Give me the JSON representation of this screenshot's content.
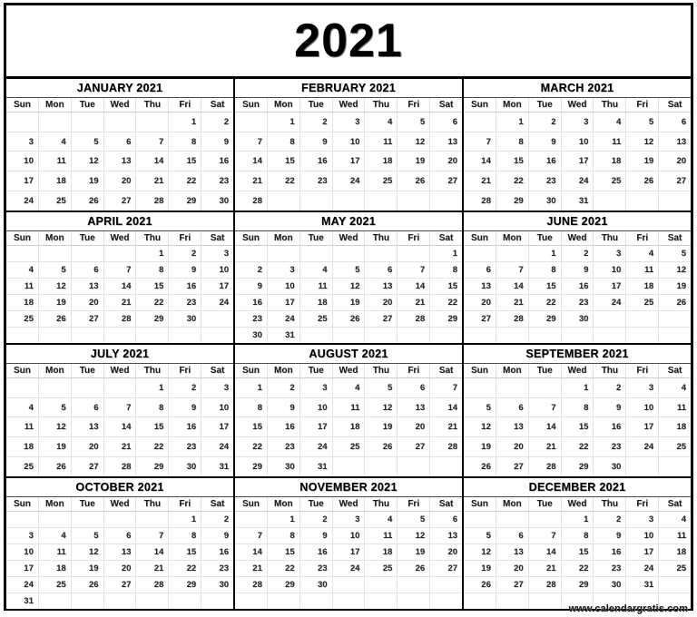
{
  "title": "2021",
  "watermark": "www.calendargratis.com",
  "weekdays": [
    "Sun",
    "Mon",
    "Tue",
    "Wed",
    "Thu",
    "Fri",
    "Sat"
  ],
  "colors": {
    "border": "#000000",
    "gridline": "#e2e2e2",
    "text": "#262626",
    "background": "#ffffff"
  },
  "quarters": [
    {
      "months": [
        {
          "name": "JANUARY 2021",
          "weeks": [
            [
              "",
              "",
              "",
              "",
              "",
              "1",
              "2"
            ],
            [
              "3",
              "4",
              "5",
              "6",
              "7",
              "8",
              "9"
            ],
            [
              "10",
              "11",
              "12",
              "13",
              "14",
              "15",
              "16"
            ],
            [
              "17",
              "18",
              "19",
              "20",
              "21",
              "22",
              "23"
            ],
            [
              "24",
              "25",
              "26",
              "27",
              "28",
              "29",
              "30"
            ]
          ]
        },
        {
          "name": "FEBRUARY 2021",
          "weeks": [
            [
              "",
              "1",
              "2",
              "3",
              "4",
              "5",
              "6"
            ],
            [
              "7",
              "8",
              "9",
              "10",
              "11",
              "12",
              "13"
            ],
            [
              "14",
              "15",
              "16",
              "17",
              "18",
              "19",
              "20"
            ],
            [
              "21",
              "22",
              "23",
              "24",
              "25",
              "26",
              "27"
            ],
            [
              "28",
              "",
              "",
              "",
              "",
              "",
              ""
            ]
          ]
        },
        {
          "name": "MARCH 2021",
          "weeks": [
            [
              "",
              "1",
              "2",
              "3",
              "4",
              "5",
              "6"
            ],
            [
              "7",
              "8",
              "9",
              "10",
              "11",
              "12",
              "13"
            ],
            [
              "14",
              "15",
              "16",
              "17",
              "18",
              "19",
              "20"
            ],
            [
              "21",
              "22",
              "23",
              "24",
              "25",
              "26",
              "27"
            ],
            [
              "28",
              "29",
              "30",
              "31",
              "",
              "",
              ""
            ]
          ]
        }
      ]
    },
    {
      "months": [
        {
          "name": "APRIL 2021",
          "weeks": [
            [
              "",
              "",
              "",
              "",
              "1",
              "2",
              "3"
            ],
            [
              "4",
              "5",
              "6",
              "7",
              "8",
              "9",
              "10"
            ],
            [
              "11",
              "12",
              "13",
              "14",
              "15",
              "16",
              "17"
            ],
            [
              "18",
              "19",
              "20",
              "21",
              "22",
              "23",
              "24"
            ],
            [
              "25",
              "26",
              "27",
              "28",
              "29",
              "30",
              ""
            ],
            [
              "",
              "",
              "",
              "",
              "",
              "",
              ""
            ]
          ]
        },
        {
          "name": "MAY 2021",
          "weeks": [
            [
              "",
              "",
              "",
              "",
              "",
              "",
              "1"
            ],
            [
              "2",
              "3",
              "4",
              "5",
              "6",
              "7",
              "8"
            ],
            [
              "9",
              "10",
              "11",
              "12",
              "13",
              "14",
              "15"
            ],
            [
              "16",
              "17",
              "18",
              "19",
              "20",
              "21",
              "22"
            ],
            [
              "23",
              "24",
              "25",
              "26",
              "27",
              "28",
              "29"
            ],
            [
              "30",
              "31",
              "",
              "",
              "",
              "",
              ""
            ]
          ]
        },
        {
          "name": "JUNE 2021",
          "weeks": [
            [
              "",
              "",
              "1",
              "2",
              "3",
              "4",
              "5"
            ],
            [
              "6",
              "7",
              "8",
              "9",
              "10",
              "11",
              "12"
            ],
            [
              "13",
              "14",
              "15",
              "16",
              "17",
              "18",
              "19"
            ],
            [
              "20",
              "21",
              "22",
              "23",
              "24",
              "25",
              "26"
            ],
            [
              "27",
              "28",
              "29",
              "30",
              "",
              "",
              ""
            ],
            [
              "",
              "",
              "",
              "",
              "",
              "",
              ""
            ]
          ]
        }
      ]
    },
    {
      "months": [
        {
          "name": "JULY 2021",
          "weeks": [
            [
              "",
              "",
              "",
              "",
              "1",
              "2",
              "3"
            ],
            [
              "4",
              "5",
              "6",
              "7",
              "8",
              "9",
              "10"
            ],
            [
              "11",
              "12",
              "13",
              "14",
              "15",
              "16",
              "17"
            ],
            [
              "18",
              "19",
              "20",
              "21",
              "22",
              "23",
              "24"
            ],
            [
              "25",
              "26",
              "27",
              "28",
              "29",
              "30",
              "31"
            ]
          ]
        },
        {
          "name": "AUGUST 2021",
          "weeks": [
            [
              "1",
              "2",
              "3",
              "4",
              "5",
              "6",
              "7"
            ],
            [
              "8",
              "9",
              "10",
              "11",
              "12",
              "13",
              "14"
            ],
            [
              "15",
              "16",
              "17",
              "18",
              "19",
              "20",
              "21"
            ],
            [
              "22",
              "23",
              "24",
              "25",
              "26",
              "27",
              "28"
            ],
            [
              "29",
              "30",
              "31",
              "",
              "",
              "",
              ""
            ]
          ]
        },
        {
          "name": "SEPTEMBER 2021",
          "weeks": [
            [
              "",
              "",
              "",
              "1",
              "2",
              "3",
              "4"
            ],
            [
              "5",
              "6",
              "7",
              "8",
              "9",
              "10",
              "11"
            ],
            [
              "12",
              "13",
              "14",
              "15",
              "16",
              "17",
              "18"
            ],
            [
              "19",
              "20",
              "21",
              "22",
              "23",
              "24",
              "25"
            ],
            [
              "26",
              "27",
              "28",
              "29",
              "30",
              "",
              ""
            ]
          ]
        }
      ]
    },
    {
      "months": [
        {
          "name": "OCTOBER 2021",
          "weeks": [
            [
              "",
              "",
              "",
              "",
              "",
              "1",
              "2"
            ],
            [
              "3",
              "4",
              "5",
              "6",
              "7",
              "8",
              "9"
            ],
            [
              "10",
              "11",
              "12",
              "13",
              "14",
              "15",
              "16"
            ],
            [
              "17",
              "18",
              "19",
              "20",
              "21",
              "22",
              "23"
            ],
            [
              "24",
              "25",
              "26",
              "27",
              "28",
              "29",
              "30"
            ],
            [
              "31",
              "",
              "",
              "",
              "",
              "",
              ""
            ]
          ]
        },
        {
          "name": "NOVEMBER 2021",
          "weeks": [
            [
              "",
              "1",
              "2",
              "3",
              "4",
              "5",
              "6"
            ],
            [
              "7",
              "8",
              "9",
              "10",
              "11",
              "12",
              "13"
            ],
            [
              "14",
              "15",
              "16",
              "17",
              "18",
              "19",
              "20"
            ],
            [
              "21",
              "22",
              "23",
              "24",
              "25",
              "26",
              "27"
            ],
            [
              "28",
              "29",
              "30",
              "",
              "",
              "",
              ""
            ],
            [
              "",
              "",
              "",
              "",
              "",
              "",
              ""
            ]
          ]
        },
        {
          "name": "DECEMBER 2021",
          "weeks": [
            [
              "",
              "",
              "",
              "1",
              "2",
              "3",
              "4"
            ],
            [
              "5",
              "6",
              "7",
              "8",
              "9",
              "10",
              "11"
            ],
            [
              "12",
              "13",
              "14",
              "15",
              "16",
              "17",
              "18"
            ],
            [
              "19",
              "20",
              "21",
              "22",
              "23",
              "24",
              "25"
            ],
            [
              "26",
              "27",
              "28",
              "29",
              "30",
              "31",
              ""
            ],
            [
              "",
              "",
              "",
              "",
              "",
              "",
              ""
            ]
          ]
        }
      ]
    }
  ]
}
